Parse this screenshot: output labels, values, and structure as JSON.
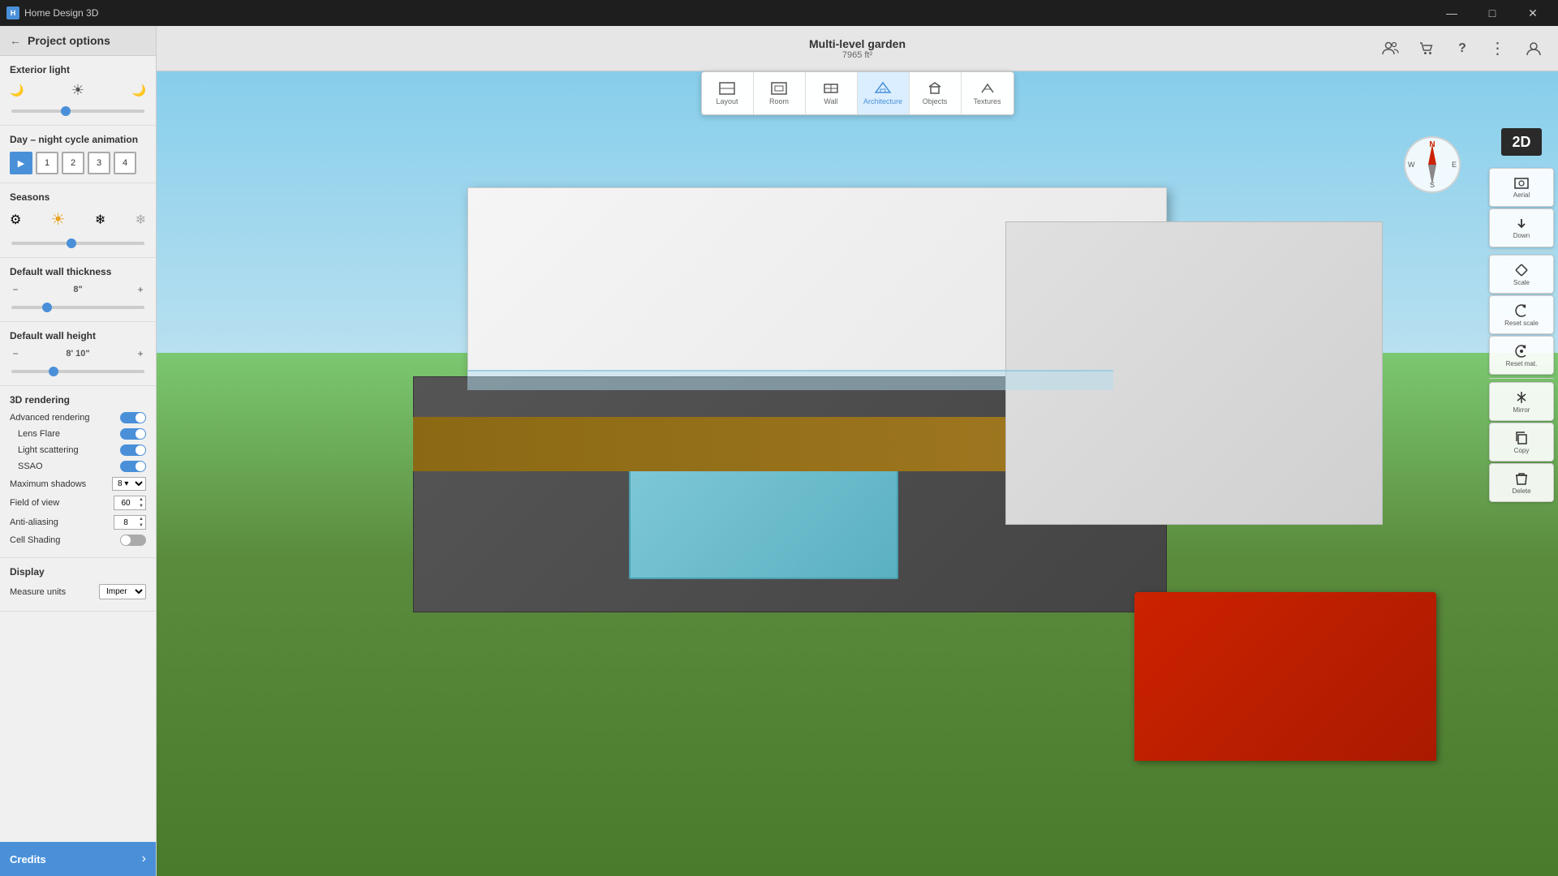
{
  "app": {
    "title": "Home Design 3D",
    "minimize": "—",
    "maximize": "□",
    "close": "✕"
  },
  "header": {
    "project_name": "Multi-level garden",
    "project_area": "7965 ft²"
  },
  "left_panel": {
    "back_label": "←",
    "title": "Project options",
    "sections": {
      "exterior_light": {
        "label": "Exterior light",
        "icon_left": "🌙",
        "icon_center": "☀",
        "icon_right": "🌙"
      },
      "day_night": {
        "label": "Day – night cycle animation",
        "buttons": [
          "▶",
          "1",
          "2",
          "3",
          "4"
        ]
      },
      "seasons": {
        "label": "Seasons",
        "icons": [
          "⚙",
          "☀",
          "❄",
          "❄"
        ]
      },
      "wall_thickness": {
        "label": "Default wall thickness",
        "value": "8\""
      },
      "wall_height": {
        "label": "Default wall height",
        "value": "8' 10\""
      },
      "rendering_3d": {
        "label": "3D rendering",
        "advanced_rendering": "Advanced rendering",
        "lens_flare": "Lens Flare",
        "light_scattering": "Light scattering",
        "ssao": "SSAO",
        "max_shadows": "Maximum shadows",
        "max_shadows_value": "8",
        "fov_label": "Field of view",
        "fov_value": "60",
        "anti_aliasing": "Anti-aliasing",
        "anti_aliasing_value": "8",
        "cell_shading": "Cell Shading"
      },
      "display": {
        "label": "Display",
        "measure_units": "Measure units",
        "measure_value": "Imper"
      }
    }
  },
  "credits": {
    "label": "Credits",
    "arrow": "›"
  },
  "nav_toolbar": {
    "buttons": [
      {
        "icon": "◻",
        "label": "Layout"
      },
      {
        "icon": "⬚",
        "label": "Room"
      },
      {
        "icon": "🧱",
        "label": "Wall"
      },
      {
        "icon": "🏛",
        "label": "Architecture"
      },
      {
        "icon": "🪑",
        "label": "Objects"
      },
      {
        "icon": "🖌",
        "label": "Textures"
      }
    ],
    "active_index": 3
  },
  "right_panel": {
    "buttons": [
      {
        "icon": "📹",
        "label": "Aerial"
      },
      {
        "icon": "⌄",
        "label": "Down"
      },
      {
        "icon": "⤢",
        "label": "Scale"
      },
      {
        "icon": "↺",
        "label": "Reset scale"
      },
      {
        "icon": "↺",
        "label": "Reset mat."
      },
      {
        "icon": "△",
        "label": "Mirror"
      },
      {
        "icon": "⧉",
        "label": "Copy"
      },
      {
        "icon": "🗑",
        "label": "Delete"
      }
    ]
  },
  "view_2d": "2D",
  "compass": {
    "n": "N",
    "s": "S",
    "e": "E",
    "w": "W"
  },
  "top_icons": {
    "users": "👥",
    "cart": "🛒",
    "help": "?",
    "menu": "⋮",
    "account": "👤"
  }
}
